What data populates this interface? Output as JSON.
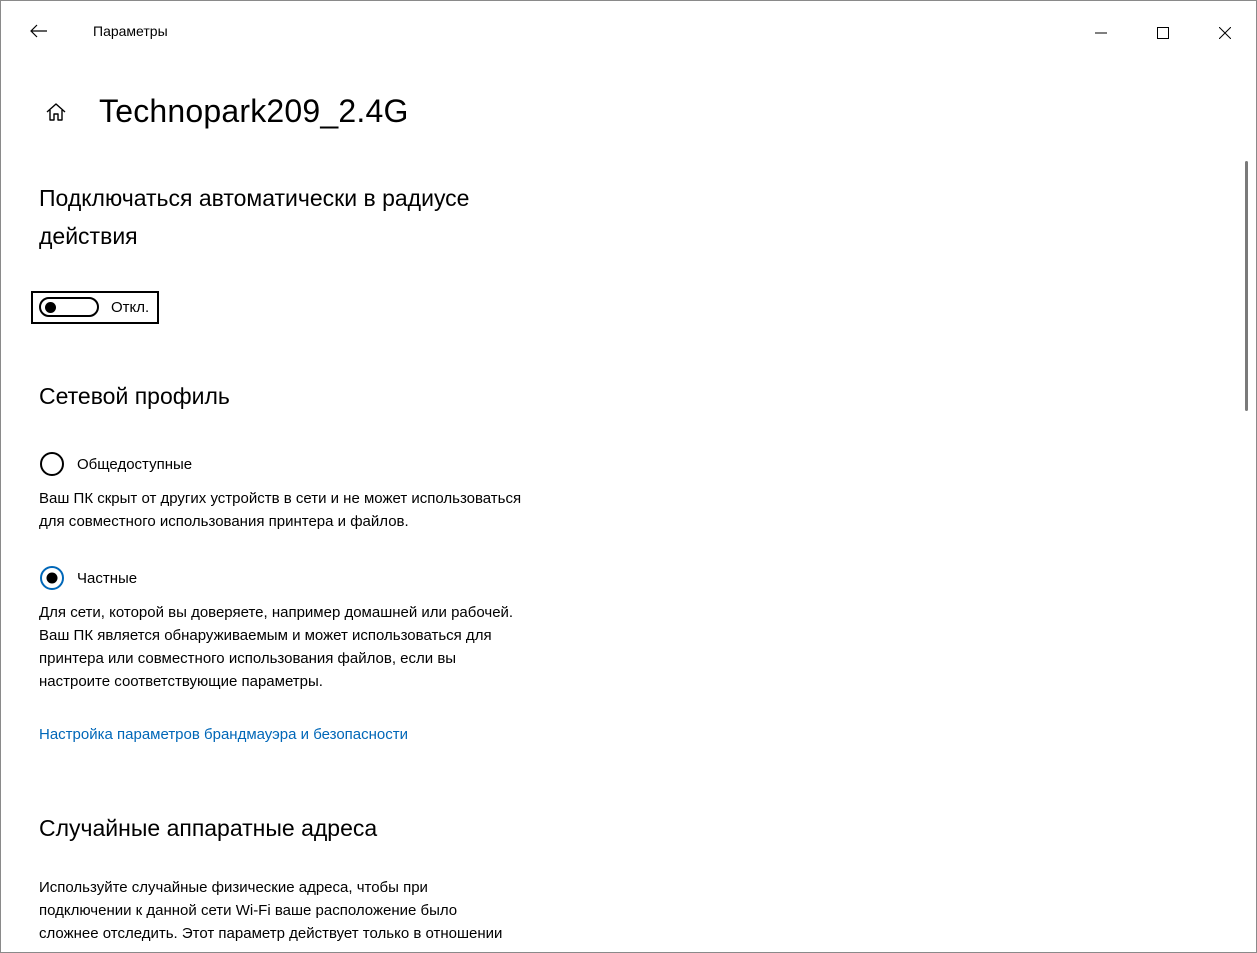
{
  "window": {
    "app_title": "Параметры"
  },
  "header": {
    "page_title": "Technopark209_2.4G"
  },
  "auto_connect": {
    "title_line1": "Подключаться автоматически в радиусе",
    "title_line2": "действия",
    "toggle_state": "Откл."
  },
  "network_profile": {
    "title": "Сетевой профиль",
    "options": [
      {
        "label": "Общедоступные",
        "selected": false,
        "desc_line1": "Ваш ПК скрыт от других устройств в сети и не может использоваться",
        "desc_line2": "для совместного использования принтера и файлов."
      },
      {
        "label": "Частные",
        "selected": true,
        "desc_line1": "Для сети, которой вы доверяете, например домашней или рабочей.",
        "desc_line2": "Ваш ПК является обнаруживаемым и может использоваться для",
        "desc_line3": "принтера или совместного использования файлов, если вы",
        "desc_line4": "настроите соответствующие параметры."
      }
    ],
    "firewall_link": "Настройка параметров брандмауэра и безопасности"
  },
  "random_hw": {
    "title": "Случайные аппаратные адреса",
    "desc_line1": "Используйте случайные физические адреса, чтобы при",
    "desc_line2": "подключении к данной сети Wi-Fi ваше расположение было",
    "desc_line3": "сложнее отследить. Этот параметр действует только в отношении"
  },
  "colors": {
    "accent": "#0067b8"
  }
}
